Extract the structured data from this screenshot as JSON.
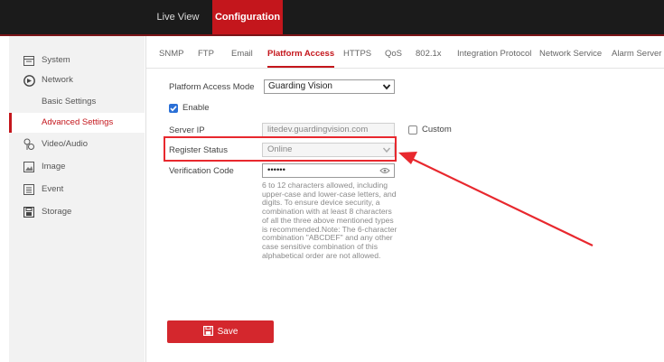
{
  "topnav": {
    "live_view": "Live View",
    "configuration": "Configuration"
  },
  "sidebar": {
    "items": [
      {
        "label": "System",
        "icon": "system-icon"
      },
      {
        "label": "Network",
        "icon": "network-icon"
      },
      {
        "label": "Basic Settings"
      },
      {
        "label": "Advanced Settings",
        "active": true
      },
      {
        "label": "Video/Audio",
        "icon": "video-audio-icon"
      },
      {
        "label": "Image",
        "icon": "image-icon"
      },
      {
        "label": "Event",
        "icon": "event-icon"
      },
      {
        "label": "Storage",
        "icon": "storage-icon"
      }
    ]
  },
  "tabs": [
    "SNMP",
    "FTP",
    "Email",
    "Platform Access",
    "HTTPS",
    "QoS",
    "802.1x",
    "Integration Protocol",
    "Network Service",
    "Alarm Server"
  ],
  "active_tab": "Platform Access",
  "form": {
    "platform_access_mode_label": "Platform Access Mode",
    "platform_access_mode_value": "Guarding Vision",
    "enable_label": "Enable",
    "enable_checked": true,
    "server_ip_label": "Server IP",
    "server_ip_value": "litedev.guardingvision.com",
    "custom_label": "Custom",
    "register_status_label": "Register Status",
    "register_status_value": "Online",
    "verification_code_label": "Verification Code",
    "verification_code_value": "••••••",
    "help_text": "6 to 12 characters allowed, including upper-case and lower-case letters, and digits. To ensure device security, a combination with at least 8 characters of all the three above mentioned types is recommended.Note: The 6-character combination \"ABCDEF\" and any other case sensitive combination of this alphabetical order are not allowed."
  },
  "save_label": "Save",
  "colors": {
    "accent": "#c4161c",
    "topbar": "#1b1b1b",
    "annotation": "#e8282e"
  }
}
